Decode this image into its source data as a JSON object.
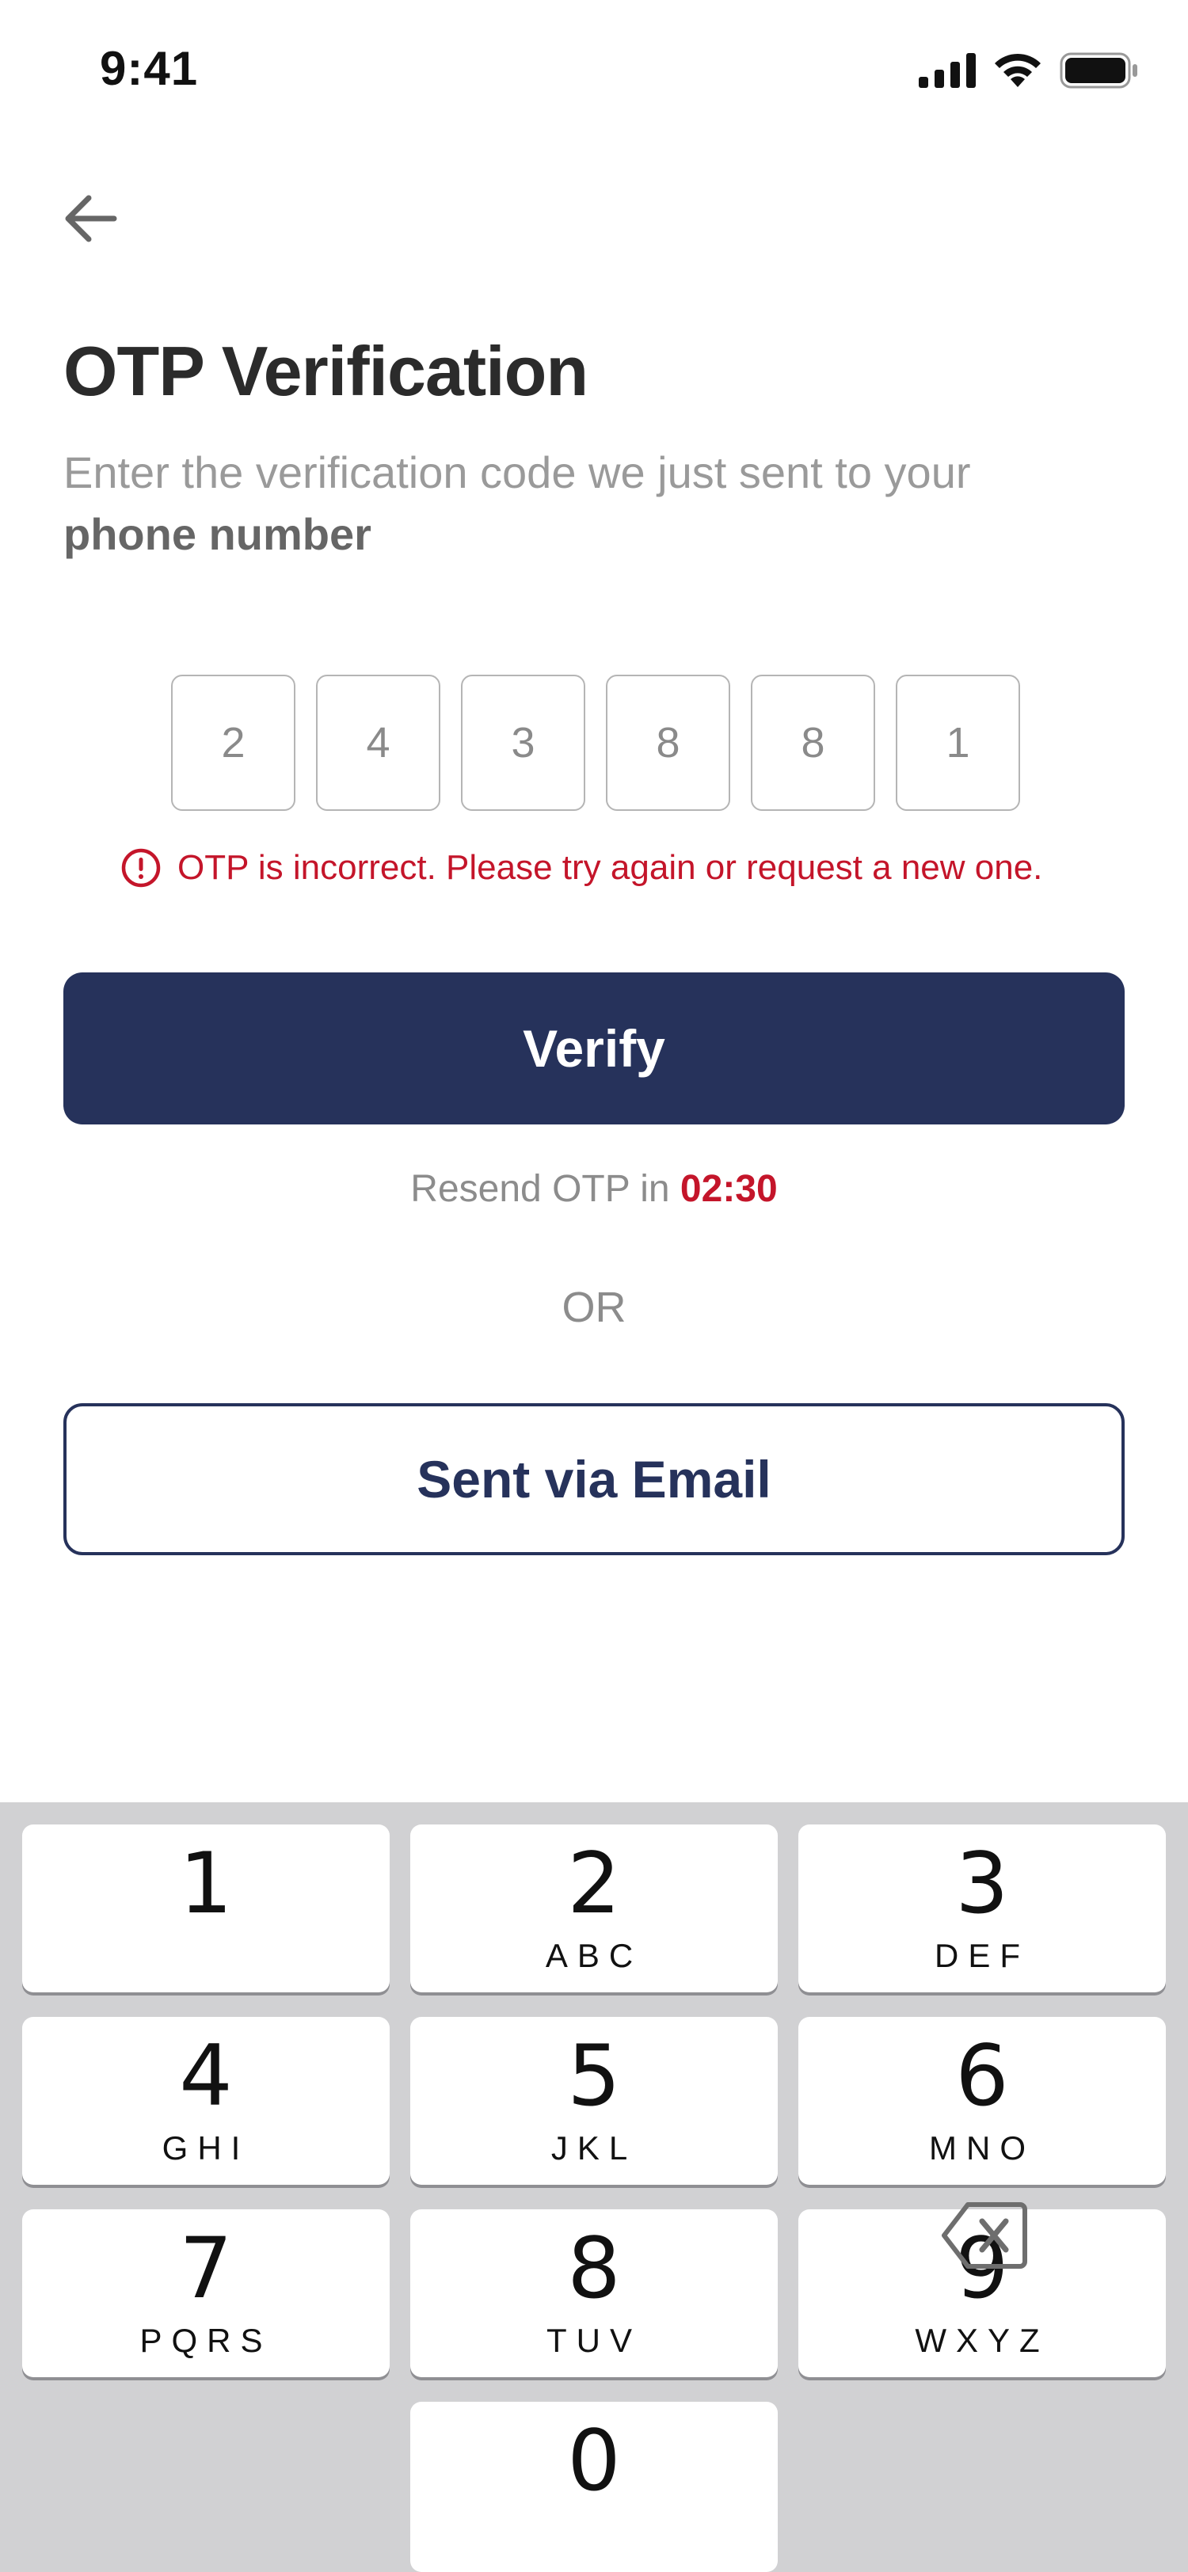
{
  "status_bar": {
    "time": "9:41",
    "icons": [
      "signal-icon",
      "wifi-icon",
      "battery-icon"
    ]
  },
  "header": {
    "back_icon": "arrow-left-icon",
    "title": "OTP Verification",
    "subtitle": "Enter the verification code we just sent to your",
    "subtitle_strong": "phone number"
  },
  "otp": {
    "digits": [
      "2",
      "4",
      "3",
      "8",
      "8",
      "1"
    ],
    "error_icon": "error-circle-icon",
    "error_text": "OTP is incorrect. Please try again or request a new one."
  },
  "actions": {
    "verify_label": "Verify",
    "resend_prefix": "Resend OTP in",
    "resend_timer": "02:30",
    "or_label": "OR",
    "email_label": "Sent via Email"
  },
  "keypad": {
    "keys": [
      {
        "num": "1",
        "letters": ""
      },
      {
        "num": "2",
        "letters": "ABC"
      },
      {
        "num": "3",
        "letters": "DEF"
      },
      {
        "num": "4",
        "letters": "GHI"
      },
      {
        "num": "5",
        "letters": "JKL"
      },
      {
        "num": "6",
        "letters": "MNO"
      },
      {
        "num": "7",
        "letters": "PQRS"
      },
      {
        "num": "8",
        "letters": "TUV"
      },
      {
        "num": "9",
        "letters": "WXYZ"
      },
      {
        "num": "0",
        "letters": ""
      }
    ],
    "delete_icon": "backspace-icon"
  },
  "colors": {
    "primary": "#26325b",
    "error": "#c4152a",
    "muted": "#9a9a9a",
    "keypad_bg": "#d1d1d3"
  }
}
